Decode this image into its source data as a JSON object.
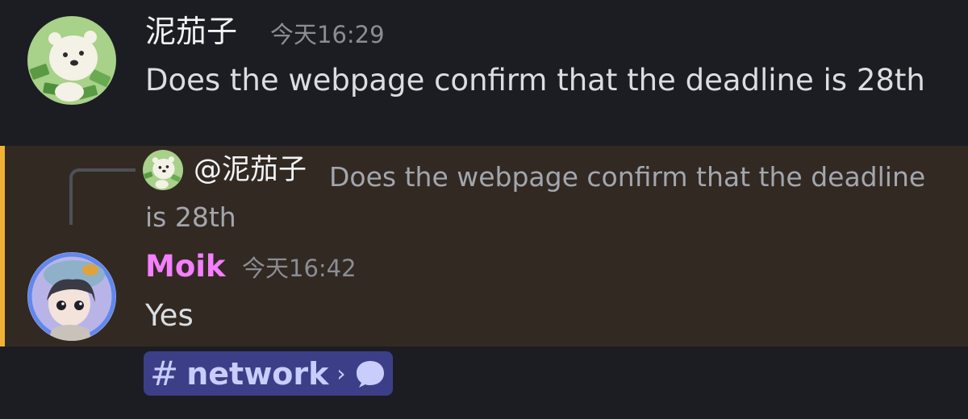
{
  "messages": [
    {
      "author": "泥茄子",
      "timestamp": "今天16:29",
      "content": "Does the webpage confirm that the deadline is 28th",
      "avatar": "bear-avatar-icon"
    },
    {
      "author": "Moik",
      "timestamp": "今天16:42",
      "content": "Yes",
      "avatar": "girl-avatar-icon",
      "reply": {
        "author": "@泥茄子",
        "content": "Does the webpage confirm that the deadline is 28th"
      }
    }
  ],
  "channel_link": {
    "name": "network",
    "hash_icon": "#",
    "chevron": "›",
    "thread_icon": "speech-bubble-icon"
  },
  "colors": {
    "background": "#1c1d22",
    "mention_highlight": "#322923",
    "mention_bar": "#f0b232",
    "moik_name": "#f47fff",
    "pill": "#3c3f87"
  }
}
